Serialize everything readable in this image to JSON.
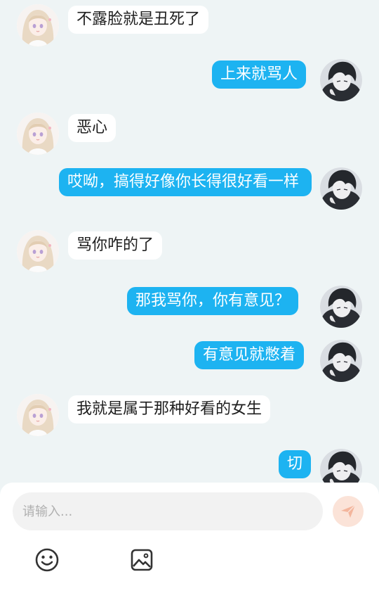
{
  "messages": [
    {
      "side": "left",
      "text": "不露脸就是丑死了"
    },
    {
      "side": "right",
      "text": "上来就骂人"
    },
    {
      "side": "left",
      "text": "恶心"
    },
    {
      "side": "right",
      "text": "哎呦，搞得好像你长得很好看一样"
    },
    {
      "side": "left",
      "text": "骂你咋的了"
    },
    {
      "side": "right",
      "text": "那我骂你，你有意见？"
    },
    {
      "side": "right",
      "text": "有意见就憋着"
    },
    {
      "side": "left",
      "text": "我就是属于那种好看的女生"
    },
    {
      "side": "right",
      "text": "切"
    }
  ],
  "composer": {
    "placeholder": "请输入...",
    "send_icon": "send-paper-plane-icon",
    "emoji_icon": "smiley-face-icon",
    "image_icon": "image-picture-icon"
  },
  "colors": {
    "background": "#eef4f5",
    "outgoing_bubble": "#1db3f1",
    "incoming_bubble": "#ffffff",
    "send_button": "#fbe3d8",
    "send_icon": "#f3b59c"
  }
}
